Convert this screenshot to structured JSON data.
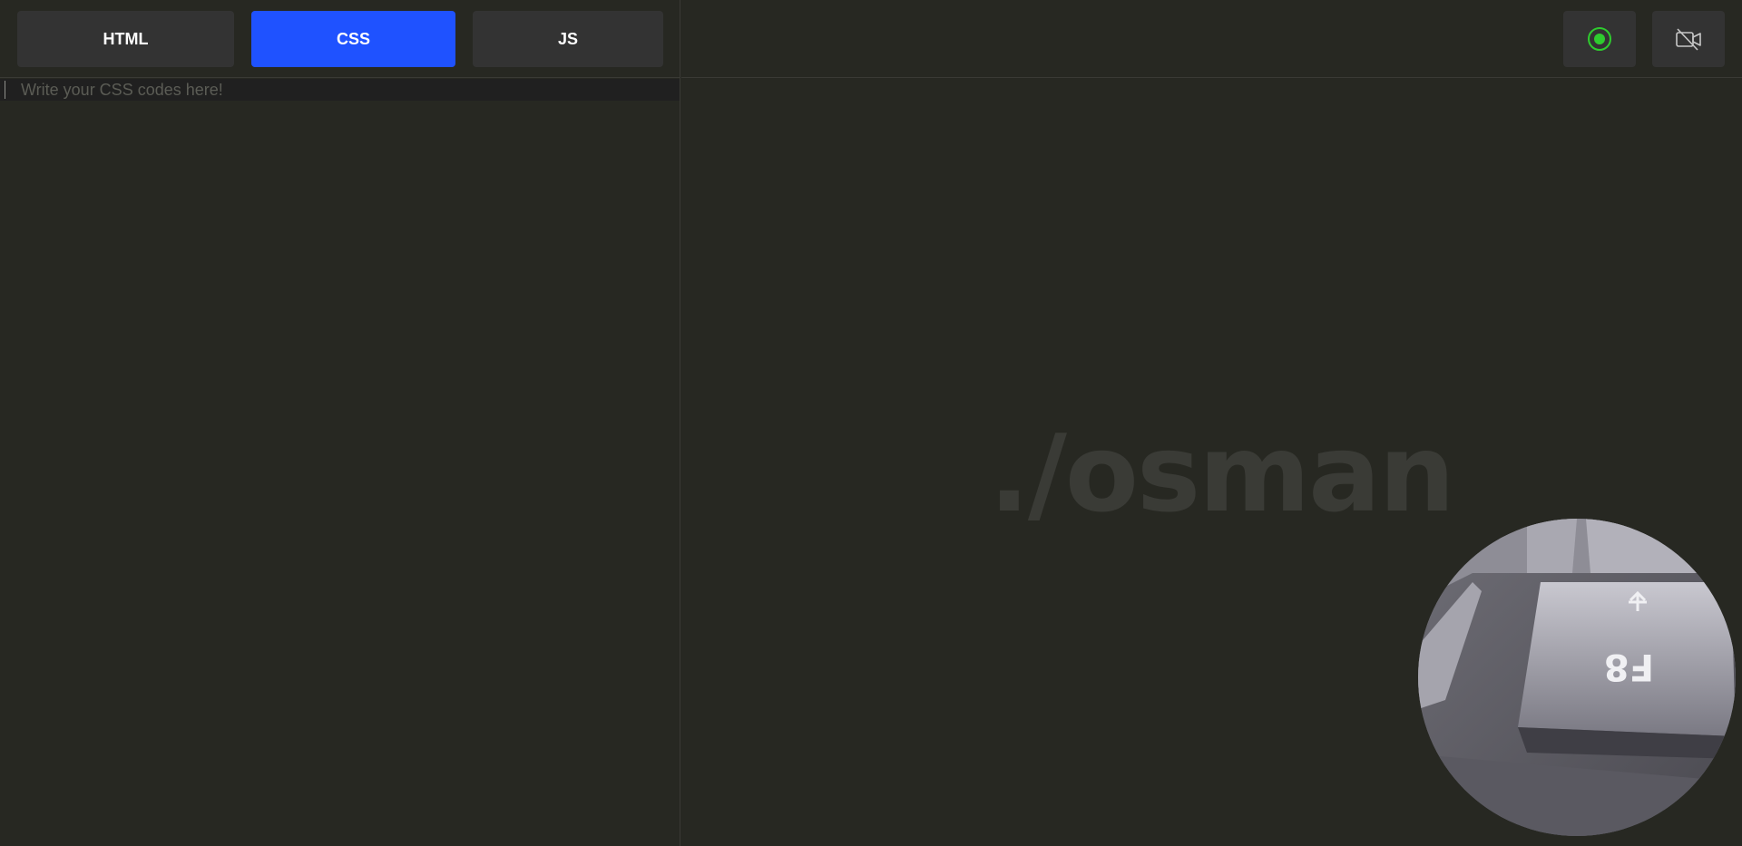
{
  "tabs": [
    {
      "label": "HTML"
    },
    {
      "label": "CSS"
    },
    {
      "label": "JS"
    }
  ],
  "active_tab": "CSS",
  "editor": {
    "placeholder": "Write your CSS codes here!",
    "value": ""
  },
  "preview": {
    "watermark": "./osman"
  },
  "toolbar": {
    "record_icon": "record-icon",
    "camera_off_icon": "camera-off-icon"
  },
  "webcam": {
    "keycap_label": "F8"
  },
  "colors": {
    "background": "#272822",
    "tab": "#333333",
    "active_tab": "#1f52ff",
    "record_accent": "#2ecc2e",
    "watermark": "#3a3b36"
  }
}
